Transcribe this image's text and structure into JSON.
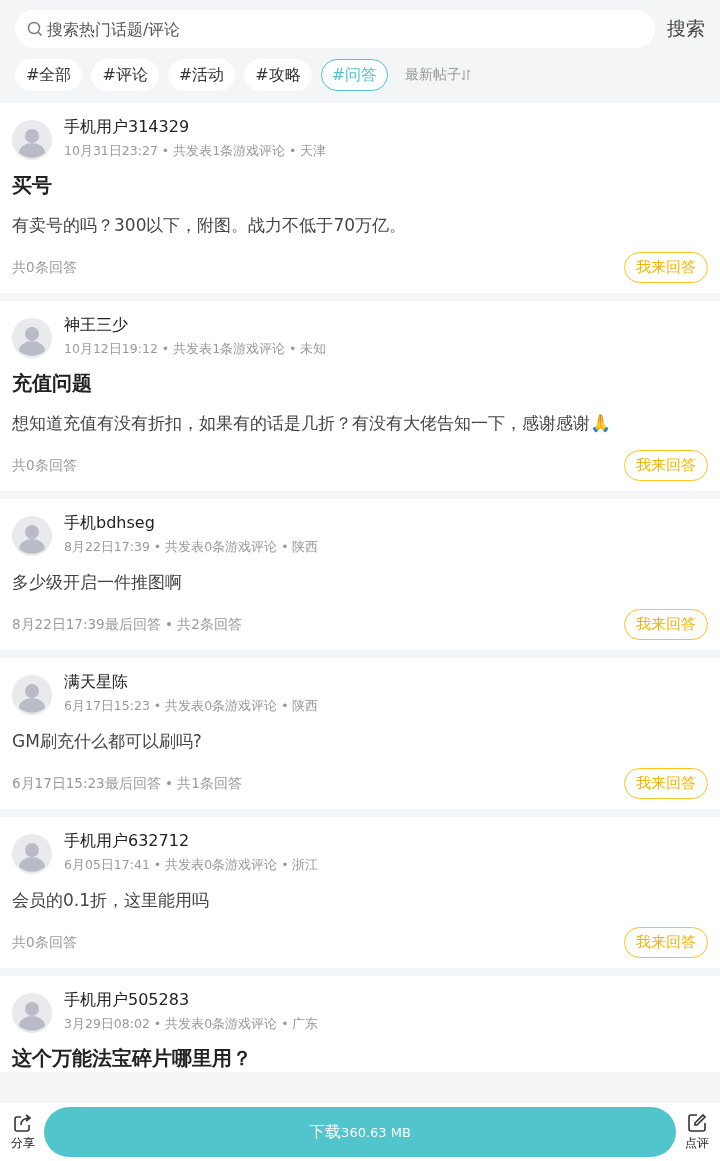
{
  "search": {
    "placeholder": "搜索热门话题/评论",
    "button": "搜索"
  },
  "tags": [
    {
      "label": "#全部",
      "selected": false
    },
    {
      "label": "#评论",
      "selected": false
    },
    {
      "label": "#活动",
      "selected": false
    },
    {
      "label": "#攻略",
      "selected": false
    },
    {
      "label": "#问答",
      "selected": true
    }
  ],
  "sort": "最新帖子",
  "posts": [
    {
      "user": "手机用户314329",
      "meta": "10月31日23:27 • 共发表1条游戏评论 • 天津",
      "title": "买号",
      "content": "有卖号的吗？300以下，附图。战力不低于70万亿。",
      "footer": "共0条回答",
      "action": "我来回答"
    },
    {
      "user": "神王三少",
      "meta": "10月12日19:12 • 共发表1条游戏评论 • 未知",
      "title": "充值问题",
      "content": "想知道充值有没有折扣，如果有的话是几折？有没有大佬告知一下，感谢感谢🙏",
      "footer": "共0条回答",
      "action": "我来回答"
    },
    {
      "user": "手机bdhseg",
      "meta": "8月22日17:39 • 共发表0条游戏评论 • 陕西",
      "content": "多少级开启一件推图啊",
      "footer": "8月22日17:39最后回答 • 共2条回答",
      "action": "我来回答"
    },
    {
      "user": "满天星陈",
      "meta": "6月17日15:23 • 共发表0条游戏评论 • 陕西",
      "content": "GM刷充什么都可以刷吗?",
      "footer": "6月17日15:23最后回答 • 共1条回答",
      "action": "我来回答"
    },
    {
      "user": "手机用户632712",
      "meta": "6月05日17:41 • 共发表0条游戏评论 • 浙江",
      "content": "会员的0.1折，这里能用吗",
      "footer": "共0条回答",
      "action": "我来回答"
    },
    {
      "user": "手机用户505283",
      "meta": "3月29日08:02 • 共发表0条游戏评论 • 广东",
      "title": "这个万能法宝碎片哪里用？"
    }
  ],
  "bottom_bar": {
    "share": "分享",
    "download": "下载",
    "size": "360.63 MB",
    "review": "点评"
  }
}
